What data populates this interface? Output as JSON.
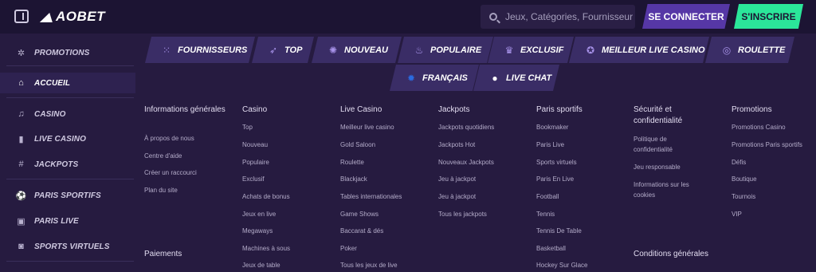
{
  "header": {
    "logo_text": "AOBET",
    "search_placeholder": "Jeux, Catégories, Fournisseurs",
    "login_label": "SE CONNECTER",
    "register_label": "S'INSCRIRE"
  },
  "sidebar": {
    "items": [
      {
        "label": "PROMOTIONS",
        "icon": "promotions-icon"
      },
      {
        "label": "ACCUEIL",
        "icon": "home-icon"
      },
      {
        "label": "CASINO",
        "icon": "music-note-icon"
      },
      {
        "label": "LIVE CASINO",
        "icon": "cards-icon"
      },
      {
        "label": "JACKPOTS",
        "icon": "jackpot-icon"
      },
      {
        "label": "PARIS SPORTIFS",
        "icon": "sports-icon"
      },
      {
        "label": "PARIS LIVE",
        "icon": "live-icon"
      },
      {
        "label": "SPORTS VIRTUELS",
        "icon": "virtual-sports-icon"
      }
    ]
  },
  "tabs": [
    {
      "label": "FOURNISSEURS",
      "icon": "grid-icon"
    },
    {
      "label": "TOP",
      "icon": "rocket-icon"
    },
    {
      "label": "NOUVEAU",
      "icon": "badge-icon"
    },
    {
      "label": "POPULAIRE",
      "icon": "fire-icon"
    },
    {
      "label": "EXCLUSIF",
      "icon": "crown-icon"
    },
    {
      "label": "MEILLEUR LIVE CASINO",
      "icon": "star-circle-icon"
    },
    {
      "label": "ROULETTE",
      "icon": "roulette-icon"
    },
    {
      "label": "FRANÇAIS",
      "icon": "eu-flag-icon"
    },
    {
      "label": "LIVE CHAT",
      "icon": "chat-icon"
    }
  ],
  "footer": {
    "columns": [
      {
        "title": "Informations générales",
        "links": [
          "À propos de nous",
          "Centre d'aide",
          "Créer un raccourci",
          "Plan du site"
        ]
      },
      {
        "title": "Casino",
        "links": [
          "Top",
          "Nouveau",
          "Populaire",
          "Exclusif",
          "Achats de bonus",
          "Jeux en live",
          "Megaways",
          "Machines à sous",
          "Jeux de table"
        ]
      },
      {
        "title": "Live Casino",
        "links": [
          "Meilleur live casino",
          "Gold Saloon",
          "Roulette",
          "Blackjack",
          "Tables internationales",
          "Game Shows",
          "Baccarat & dés",
          "Poker",
          "Tous les jeux de live"
        ]
      },
      {
        "title": "Jackpots",
        "links": [
          "Jackpots quotidiens",
          "Jackpots Hot",
          "Nouveaux Jackpots",
          "Jeu à jackpot",
          "Jeu à jackpot",
          "Tous les jackpots"
        ]
      },
      {
        "title": "Paris sportifs",
        "links": [
          "Bookmaker",
          "Paris Live",
          "Sports virtuels",
          "Paris En Live",
          "Football",
          "Tennis",
          "Tennis De Table",
          "Basketball",
          "Hockey Sur Glace"
        ]
      },
      {
        "title": "Sécurité et confidentialité",
        "links": [
          "Politique de confidentialité",
          "Jeu responsable",
          "Informations sur les cookies"
        ]
      },
      {
        "title": "Promotions",
        "links": [
          "Promotions Casino",
          "Promotions Paris sportifs",
          "Défis",
          "Boutique",
          "Tournois",
          "VIP"
        ]
      }
    ],
    "payments_title": "Paiements",
    "terms_title": "Conditions générales"
  },
  "colors": {
    "background": "#261b40",
    "header": "#1c1433",
    "login_button": "#5637a6",
    "register_button": "#2be69a",
    "tab": "#3a2d66"
  }
}
